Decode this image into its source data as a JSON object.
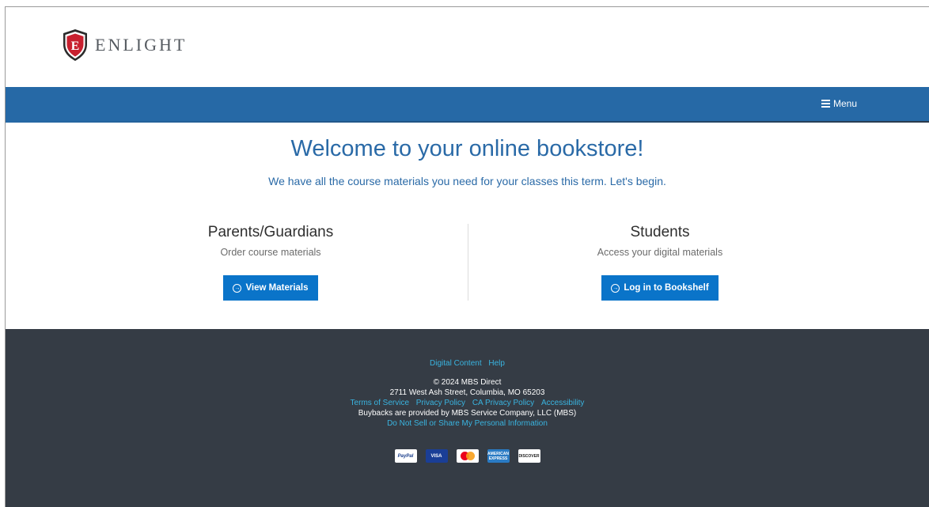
{
  "header": {
    "logo_text": "ENLIGHT",
    "logo_letter": "E"
  },
  "nav": {
    "menu_label": "Menu"
  },
  "welcome": {
    "title": "Welcome to your online bookstore!",
    "subtitle": "We have all the course materials you need for your classes this term. Let's begin."
  },
  "parents": {
    "heading": "Parents/Guardians",
    "description": "Order course materials",
    "button_label": "View Materials"
  },
  "students": {
    "heading": "Students",
    "description": "Access your digital materials",
    "button_label": "Log in to Bookshelf"
  },
  "footer": {
    "links_top": [
      "Digital Content",
      "Help"
    ],
    "copyright": "© 2024 MBS Direct",
    "address": "2711 West Ash Street, Columbia, MO 65203",
    "policy_links": [
      "Terms of Service",
      "Privacy Policy",
      "CA Privacy Policy",
      "Accessibility"
    ],
    "buyback_text": "Buybacks are provided by MBS Service Company, LLC (MBS)",
    "do_not_sell": "Do Not Sell or Share My Personal Information",
    "payment_cards": {
      "paypal": "PayPal",
      "visa": "VISA",
      "amex": "AMERICAN EXPRESS",
      "discover": "DISCOVER"
    }
  },
  "colors": {
    "brand_blue": "#2669a6",
    "button_blue": "#0a74c9",
    "footer_bg": "#353c45",
    "footer_link": "#39b4e0",
    "shield_red": "#c8202f"
  }
}
